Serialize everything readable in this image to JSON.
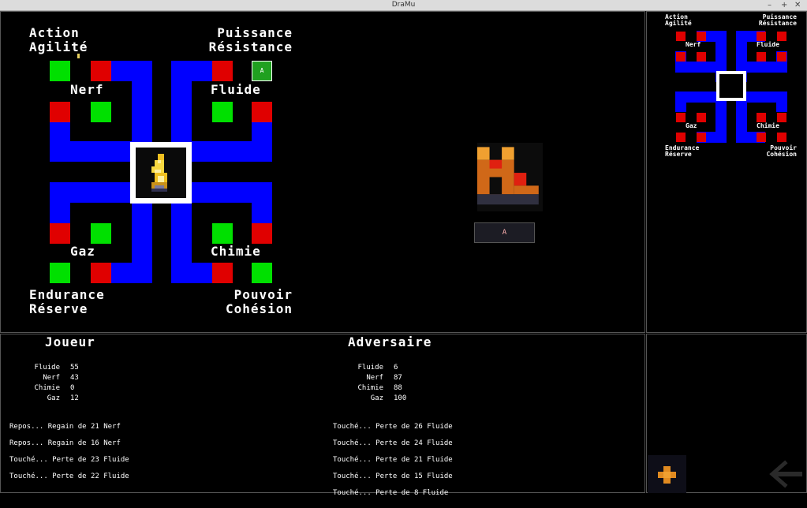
{
  "window": {
    "title": "DraMu",
    "min": "–",
    "max": "+",
    "close": "✕"
  },
  "board": {
    "corners": {
      "tl": [
        "Action",
        "Agilité"
      ],
      "tr": [
        "Puissance",
        "Résistance"
      ],
      "bl": [
        "Endurance",
        "Réserve"
      ],
      "br": [
        "Pouvoir",
        "Cohésion"
      ]
    },
    "quadrants": {
      "tl": "Nerf",
      "tr": "Fluide",
      "bl": "Gaz",
      "br": "Chimie"
    },
    "cell_button_label": "A"
  },
  "item": {
    "button_label": "A"
  },
  "player": {
    "title": "Joueur",
    "stats": [
      {
        "name": "Fluide",
        "value": "55"
      },
      {
        "name": "Nerf",
        "value": "43"
      },
      {
        "name": "Chimie",
        "value": "0"
      },
      {
        "name": "Gaz",
        "value": "12"
      }
    ],
    "log": [
      "Repos... Regain de 21 Nerf",
      "Repos... Regain de 16 Nerf",
      "Touché... Perte de 23 Fluide",
      "Touché... Perte de 22 Fluide"
    ]
  },
  "opponent": {
    "title": "Adversaire",
    "stats": [
      {
        "name": "Fluide",
        "value": "6"
      },
      {
        "name": "Nerf",
        "value": "87"
      },
      {
        "name": "Chimie",
        "value": "88"
      },
      {
        "name": "Gaz",
        "value": "100"
      }
    ],
    "log": [
      "Touché... Perte de 26 Fluide",
      "Touché... Perte de 24 Fluide",
      "Touché... Perte de 21 Fluide",
      "Touché... Perte de 15 Fluide",
      "Touché... Perte de 8 Fluide"
    ]
  },
  "icons": {
    "flame": "flame-icon",
    "boot": "boot-icon",
    "plus": "plus-icon",
    "back": "back-arrow-icon"
  }
}
